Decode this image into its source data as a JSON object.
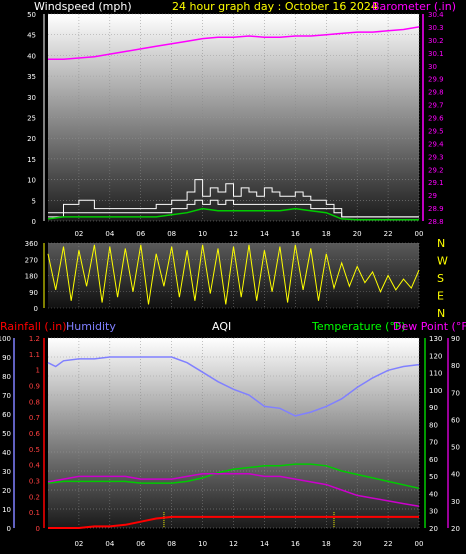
{
  "header": {
    "windspeed_label": "Windspeed (mph)",
    "title": "24 hour graph day : October 16 2024",
    "barometer_label": "Barometer (.in)"
  },
  "bottom_header": {
    "rainfall_label": "Rainfall (.in)",
    "humidity_label": "Humidity",
    "aqi_label": "AQI",
    "temperature_label": "Temperature (°F)",
    "dewpoint_label": "Dew Point (°F)"
  },
  "colors": {
    "windspeed": "#ffffff",
    "gust": "#ffffff",
    "wind_avg": "#00cc00",
    "barometer": "#ff00ff",
    "direction": "#ffff00",
    "rain": "#ff0000",
    "humidity": "#8080ff",
    "temperature": "#00cc00",
    "dewpoint": "#cc00cc",
    "title": "#ffff00"
  },
  "x_tick_labels": [
    "02",
    "04",
    "06",
    "08",
    "10",
    "12",
    "14",
    "16",
    "18",
    "20",
    "22",
    "00"
  ],
  "chart_data": [
    {
      "type": "line",
      "name": "wind-barometer",
      "x_hours": [
        0,
        24
      ],
      "left_axis": {
        "label": "Windspeed (mph)",
        "ticks": [
          0,
          5,
          10,
          15,
          20,
          25,
          30,
          35,
          40,
          45,
          50
        ],
        "ylim": [
          0,
          50
        ]
      },
      "right_axis": {
        "label": "Barometer (.in)",
        "ticks": [
          "28.8",
          "28.9",
          "29",
          "29.1",
          "29.2",
          "29.3",
          "29.4",
          "29.5",
          "29.6",
          "29.7",
          "29.8",
          "29.9",
          "30",
          "30.1",
          "30.2",
          "30.3",
          "30.4"
        ],
        "ylim": [
          28.8,
          30.4
        ]
      },
      "series": [
        {
          "key": "barometer",
          "axis": "right",
          "x": [
            0,
            1,
            2,
            3,
            4,
            5,
            6,
            7,
            8,
            9,
            10,
            11,
            12,
            13,
            14,
            15,
            16,
            17,
            18,
            19,
            20,
            21,
            22,
            23,
            24
          ],
          "values": [
            30.05,
            30.05,
            30.06,
            30.07,
            30.09,
            30.11,
            30.13,
            30.15,
            30.17,
            30.19,
            30.21,
            30.22,
            30.22,
            30.23,
            30.22,
            30.22,
            30.23,
            30.23,
            30.24,
            30.25,
            30.26,
            30.26,
            30.27,
            30.28,
            30.3
          ]
        },
        {
          "key": "gust",
          "axis": "left",
          "x": [
            0,
            1,
            2,
            3,
            4,
            5,
            6,
            7,
            8,
            9,
            9.5,
            10,
            10.5,
            11,
            11.5,
            12,
            12.5,
            13,
            13.5,
            14,
            14.5,
            15,
            15.5,
            16,
            16.5,
            17,
            17.5,
            18,
            18.5,
            19,
            20,
            21,
            22,
            23,
            24
          ],
          "values": [
            2,
            4,
            5,
            3,
            3,
            3,
            3,
            4,
            5,
            7,
            10,
            6,
            8,
            7,
            9,
            6,
            8,
            7,
            6,
            8,
            7,
            6,
            6,
            7,
            6,
            5,
            5,
            4,
            3,
            1,
            1,
            1,
            1,
            1,
            1
          ]
        },
        {
          "key": "windspeed",
          "axis": "left",
          "x": [
            0,
            1,
            2,
            3,
            4,
            5,
            6,
            7,
            8,
            9,
            9.5,
            10,
            10.5,
            11,
            11.5,
            12,
            12.5,
            13,
            13.5,
            14,
            14.5,
            15,
            15.5,
            16,
            16.5,
            17,
            17.5,
            18,
            18.5,
            19,
            20,
            21,
            22,
            23,
            24
          ],
          "values": [
            1,
            2,
            2,
            2,
            2,
            2,
            2,
            2,
            3,
            4,
            5,
            4,
            5,
            4,
            5,
            4,
            4,
            4,
            4,
            4,
            4,
            4,
            4,
            4,
            4,
            3,
            3,
            3,
            2,
            1,
            1,
            1,
            1,
            1,
            1
          ]
        },
        {
          "key": "wind_avg",
          "axis": "left",
          "x": [
            0,
            1,
            2,
            3,
            4,
            5,
            6,
            7,
            8,
            9,
            10,
            11,
            12,
            13,
            14,
            15,
            16,
            17,
            18,
            19,
            20,
            21,
            22,
            23,
            24
          ],
          "values": [
            0.5,
            1,
            1,
            1,
            1,
            1,
            1,
            1,
            1.5,
            2,
            3,
            2.5,
            2.5,
            2.5,
            2.5,
            2.5,
            3,
            2.5,
            2,
            0.5,
            0.3,
            0.3,
            0.3,
            0.3,
            0.3
          ]
        }
      ]
    },
    {
      "type": "line",
      "name": "wind-direction",
      "axis": {
        "ticks": [
          0,
          90,
          180,
          270,
          360
        ],
        "ylim": [
          0,
          360
        ]
      },
      "compass_labels": [
        "N",
        "W",
        "S",
        "E",
        "N"
      ],
      "series": [
        {
          "key": "direction",
          "x": [
            0,
            0.5,
            1,
            1.5,
            2,
            2.5,
            3,
            3.5,
            4,
            4.5,
            5,
            5.5,
            6,
            6.5,
            7,
            7.5,
            8,
            8.5,
            9,
            9.5,
            10,
            10.5,
            11,
            11.5,
            12,
            12.5,
            13,
            13.5,
            14,
            14.5,
            15,
            15.5,
            16,
            16.5,
            17,
            17.5,
            18,
            18.5,
            19,
            19.5,
            20,
            20.5,
            21,
            21.5,
            22,
            22.5,
            23,
            23.5,
            24
          ],
          "values": [
            300,
            100,
            340,
            40,
            320,
            120,
            350,
            30,
            340,
            60,
            330,
            90,
            350,
            20,
            300,
            120,
            340,
            60,
            320,
            40,
            350,
            80,
            330,
            20,
            340,
            60,
            350,
            40,
            320,
            90,
            340,
            30,
            350,
            100,
            330,
            40,
            300,
            110,
            250,
            120,
            230,
            140,
            200,
            90,
            180,
            100,
            160,
            110,
            210
          ]
        }
      ]
    },
    {
      "type": "line",
      "name": "rain-humidity-temperature",
      "rain_axis": {
        "label": "Rainfall (.in)",
        "ticks": [
          "0",
          "0.1",
          "0.2",
          "0.3",
          "0.4",
          "0.5",
          "0.6",
          "0.7",
          "0.8",
          "0.9",
          "1",
          "1.1",
          "1.2"
        ],
        "ylim": [
          0,
          1.2
        ]
      },
      "humidity_axis": {
        "label": "Humidity",
        "ticks": [
          0,
          10,
          20,
          30,
          40,
          50,
          60,
          70,
          80,
          90,
          100
        ],
        "ylim": [
          0,
          100
        ]
      },
      "temperature_axis": {
        "label": "Temperature (°F)",
        "ticks": [
          20,
          30,
          40,
          50,
          60,
          70,
          80,
          90,
          100,
          110,
          120,
          130
        ],
        "ylim": [
          20,
          130
        ]
      },
      "dewpoint_axis": {
        "label": "Dew Point (°F)",
        "ticks": [
          20,
          30,
          40,
          50,
          60,
          70,
          80,
          90
        ],
        "ylim": [
          20,
          90
        ]
      },
      "series": [
        {
          "key": "humidity",
          "axis": "humidity",
          "x": [
            0,
            0.5,
            1,
            2,
            3,
            4,
            5,
            6,
            7,
            8,
            9,
            10,
            11,
            12,
            13,
            14,
            15,
            16,
            17,
            18,
            19,
            20,
            21,
            22,
            23,
            24
          ],
          "values": [
            87,
            85,
            88,
            89,
            89,
            90,
            90,
            90,
            90,
            90,
            87,
            82,
            77,
            73,
            70,
            64,
            63,
            59,
            61,
            64,
            68,
            74,
            79,
            83,
            85,
            86
          ]
        },
        {
          "key": "temperature",
          "axis": "temperature",
          "x": [
            0,
            1,
            2,
            3,
            4,
            5,
            6,
            7,
            8,
            9,
            10,
            11,
            12,
            13,
            14,
            15,
            16,
            17,
            18,
            19,
            20,
            21,
            22,
            23,
            24
          ],
          "values": [
            46,
            47,
            47,
            47,
            47,
            47,
            46,
            46,
            46,
            47,
            49,
            52,
            54,
            55,
            56,
            56,
            57,
            57,
            56,
            53,
            51,
            49,
            47,
            45,
            43
          ]
        },
        {
          "key": "dewpoint",
          "axis": "dewpoint",
          "x": [
            0,
            1,
            2,
            3,
            4,
            5,
            6,
            7,
            8,
            9,
            10,
            11,
            12,
            13,
            14,
            15,
            16,
            17,
            18,
            19,
            20,
            21,
            22,
            23,
            24
          ],
          "values": [
            37,
            38,
            39,
            39,
            39,
            39,
            38,
            38,
            38,
            39,
            40,
            40,
            40,
            40,
            39,
            39,
            38,
            37,
            36,
            34,
            32,
            31,
            30,
            29,
            28
          ]
        },
        {
          "key": "rain",
          "axis": "rain",
          "x": [
            0,
            1,
            2,
            3,
            4,
            5,
            6,
            7,
            8,
            9,
            10,
            11,
            12,
            13,
            14,
            15,
            16,
            17,
            18,
            19,
            20,
            21,
            22,
            23,
            24
          ],
          "values": [
            0,
            0,
            0,
            0.01,
            0.01,
            0.02,
            0.04,
            0.06,
            0.07,
            0.07,
            0.07,
            0.07,
            0.07,
            0.07,
            0.07,
            0.07,
            0.07,
            0.07,
            0.07,
            0.07,
            0.07,
            0.07,
            0.07,
            0.07,
            0.07
          ]
        }
      ],
      "markers_hours": [
        7.5,
        18.5
      ]
    }
  ]
}
